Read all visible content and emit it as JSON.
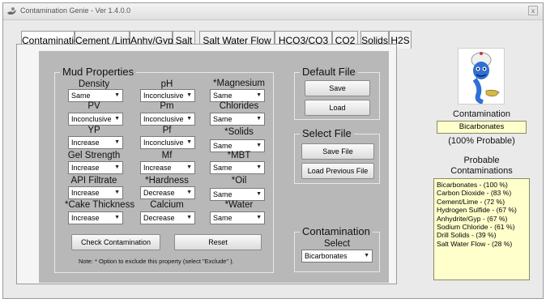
{
  "window": {
    "title": "Contamination Genie - Ver 1.4.0.0",
    "close_label": "x"
  },
  "tabs": [
    {
      "label": "Contamination"
    },
    {
      "label": "Cement /Lime"
    },
    {
      "label": "Anhy/Gyp"
    },
    {
      "label": "Salt"
    },
    {
      "label": "Salt Water Flow"
    },
    {
      "label": "HCO3/CO3"
    },
    {
      "label": "CO2"
    },
    {
      "label": "Solids"
    },
    {
      "label": "H2S"
    }
  ],
  "mud_properties": {
    "title": "Mud Properties",
    "fields": [
      {
        "label": "Density",
        "value": "Same"
      },
      {
        "label": "pH",
        "value": "Inconclusive"
      },
      {
        "label": "*Magnesium",
        "value": "Same"
      },
      {
        "label": "PV",
        "value": "Inconclusive"
      },
      {
        "label": "Pm",
        "value": "Inconclusive"
      },
      {
        "label": "Chlorides",
        "value": "Same"
      },
      {
        "label": "YP",
        "value": "Increase"
      },
      {
        "label": "Pf",
        "value": "Inconclusive"
      },
      {
        "label": "*Solids",
        "value": "Same"
      },
      {
        "label": "Gel Strength",
        "value": "Increase"
      },
      {
        "label": "Mf",
        "value": "Increase"
      },
      {
        "label": "*MBT",
        "value": "Same"
      },
      {
        "label": "API Filtrate",
        "value": "Increase"
      },
      {
        "label": "*Hardness",
        "value": "Decrease"
      },
      {
        "label": "*Oil",
        "value": "Same"
      },
      {
        "label": "*Cake Thickness",
        "value": "Increase"
      },
      {
        "label": "Calcium",
        "value": "Decrease"
      },
      {
        "label": "*Water",
        "value": "Same"
      }
    ],
    "check_button": "Check Contamination",
    "reset_button": "Reset",
    "note": "Note: * Option to exclude this property (select \"Exclude\" )."
  },
  "default_file": {
    "title": "Default File",
    "save_button": "Save",
    "load_button": "Load"
  },
  "select_file": {
    "title": "Select File",
    "save_file_button": "Save File",
    "load_previous_button": "Load Previous File"
  },
  "contamination_select": {
    "title": "Contamination",
    "subtitle": "Select",
    "value": "Bicarbonates"
  },
  "result": {
    "heading": "Contamination",
    "value": "Bicarbonates",
    "probability_text": "(100% Probable)"
  },
  "probable": {
    "heading_line1": "Probable",
    "heading_line2": "Contaminations",
    "items": [
      "Bicarbonates - (100 %)",
      "Carbon Dioxide - (83 %)",
      "Cement/Lime - (72 %)",
      "Hydrogen Sulfide - (67 %)",
      "Anhydrite/Gyp - (67 %)",
      "Sodium Chloride - (61 %)",
      "Drill Solids - (39 %)",
      "Salt Water Flow - (28 %)"
    ]
  },
  "icons": {
    "app": "genie-lamp-icon",
    "mascot": "genie-icon",
    "dropdown": "chevron-down-icon"
  }
}
